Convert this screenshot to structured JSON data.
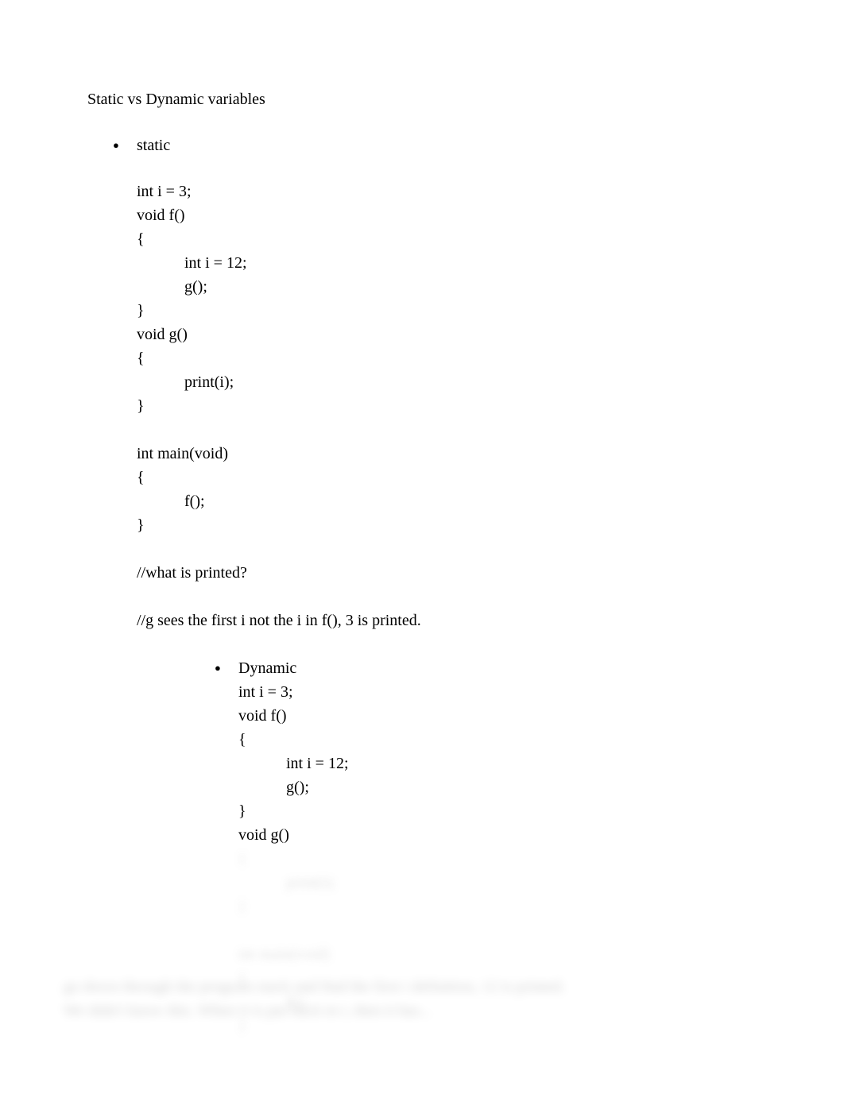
{
  "title": "Static vs Dynamic variables",
  "static_label": "static",
  "static_code": {
    "l1": "int i = 3;",
    "l2": "void f()",
    "l3": "{",
    "l4": "int i = 12;",
    "l5": "g();",
    "l6": "}",
    "l7": "void g()",
    "l8": "{",
    "l9": "print(i);",
    "l10": "}",
    "l11": "int main(void)",
    "l12": "{",
    "l13": "f();",
    "l14": "}",
    "comment1": "//what is printed?",
    "comment2": "//g sees the first i not the i in f(), 3 is printed."
  },
  "dynamic_label": "Dynamic",
  "dynamic_code": {
    "l1": "int i = 3;",
    "l2": "void f()",
    "l3": "{",
    "l4": "int i = 12;",
    "l5": "g();",
    "l6": "}",
    "l7": "void g()",
    "l8": "{",
    "l9": "print(i);",
    "l10": "}",
    "l11": "int main(void)",
    "l12": "{",
    "l13": "f();",
    "l14": "}"
  },
  "blurred_bottom": {
    "line1": "go down through the program stack and find the first i definition, 12 is printed.",
    "line2": "We didn't know this. When it is put back in i, then it has..."
  }
}
